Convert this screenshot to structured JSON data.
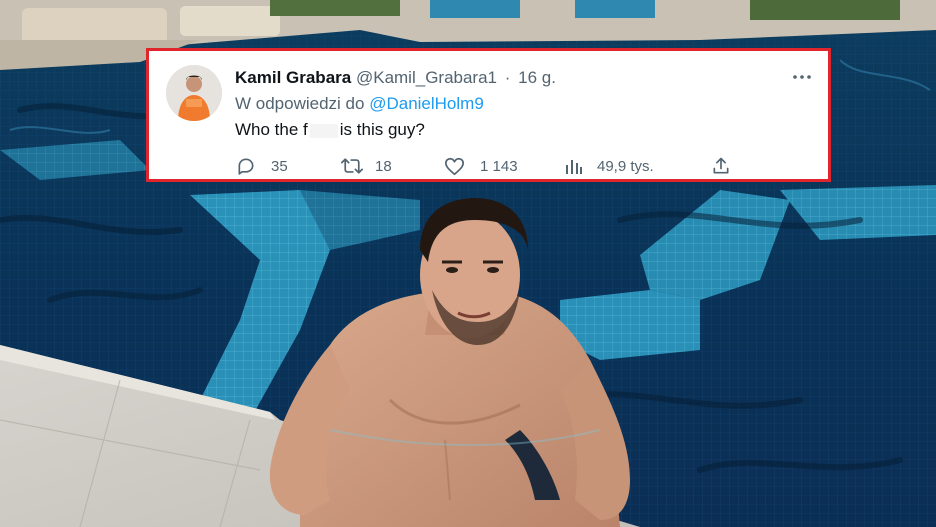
{
  "tweet": {
    "display_name": "Kamil Grabara",
    "handle": "@Kamil_Grabara1",
    "separator": "·",
    "timestamp": "16 g.",
    "reply_prefix": "W odpowiedzi do",
    "reply_to": "@DanielHolm9",
    "text_before": "Who the f",
    "text_after": "is this guy?",
    "stats": {
      "replies": "35",
      "retweets": "18",
      "likes": "1 143",
      "views": "49,9 tys."
    }
  },
  "colors": {
    "border": "#e0262c",
    "link": "#1d9bf0",
    "muted": "#536471",
    "text": "#0f1419"
  },
  "icons": [
    "reply-icon",
    "retweet-icon",
    "like-icon",
    "views-icon",
    "share-icon",
    "more-icon"
  ]
}
